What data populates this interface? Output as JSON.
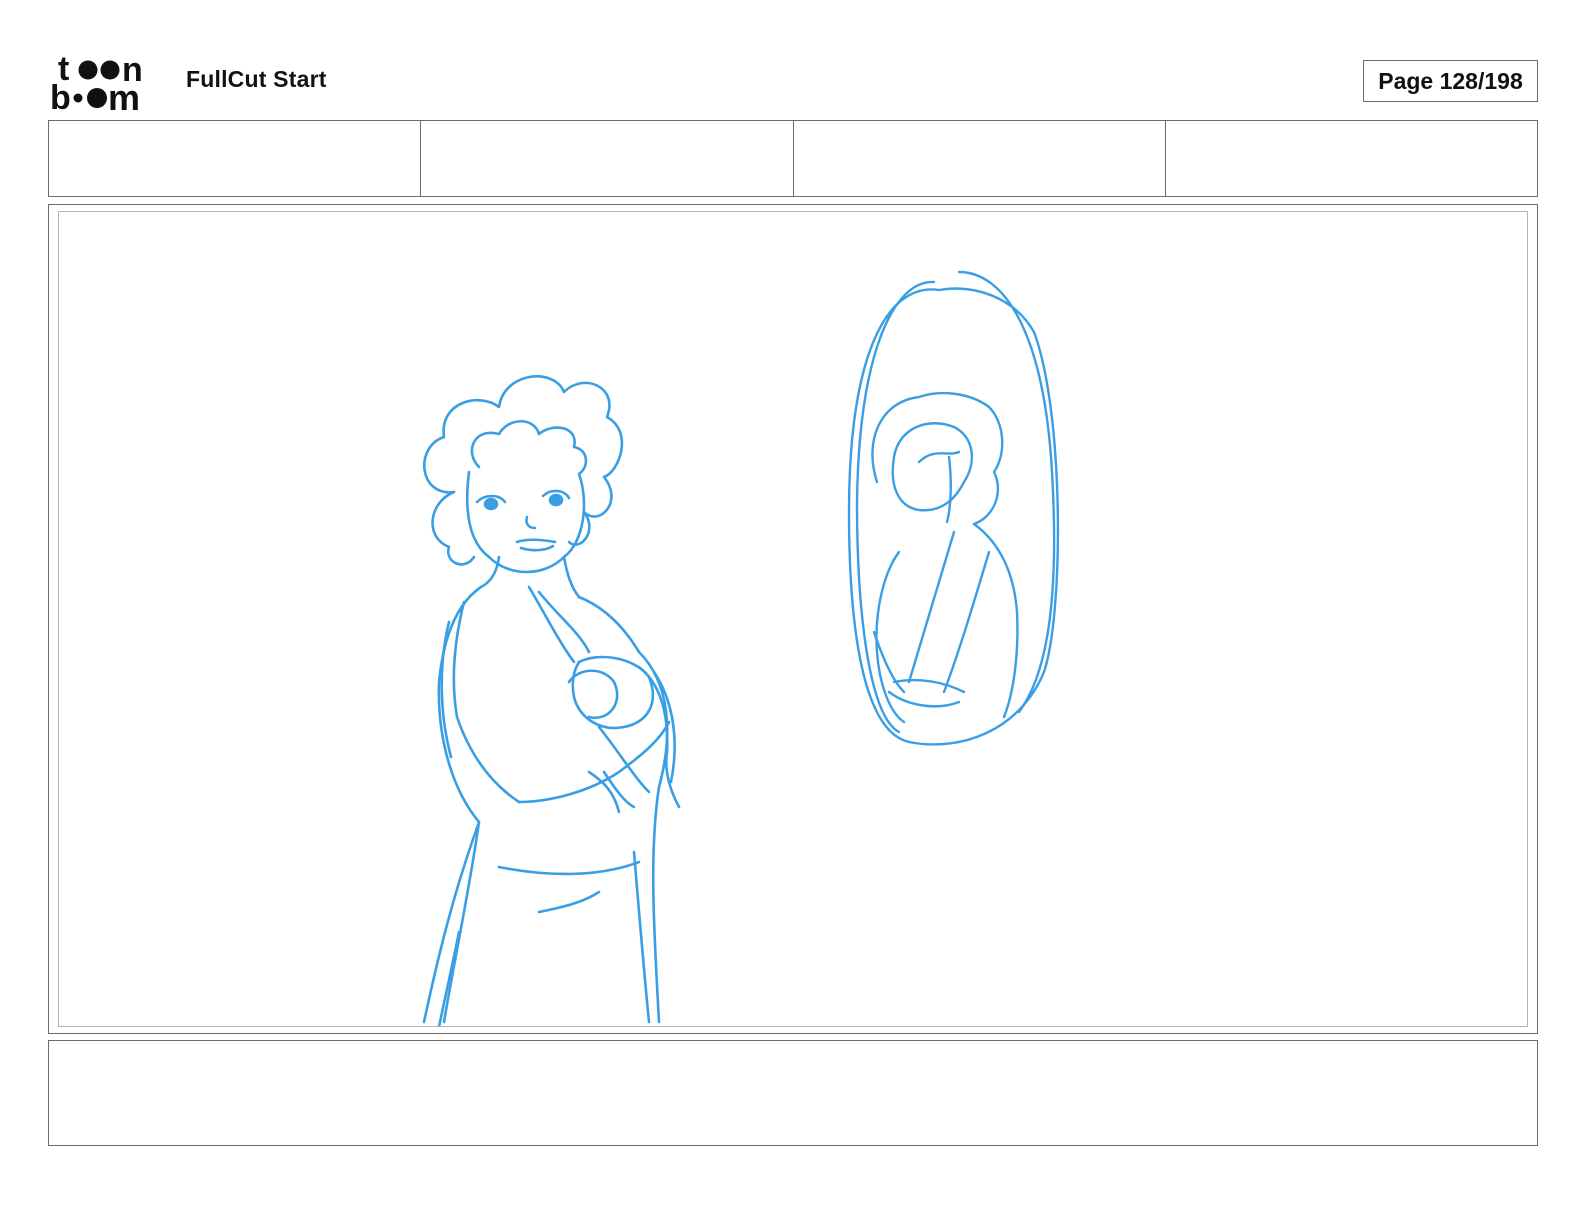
{
  "header": {
    "logo_top": "t••n",
    "logo_bottom": "b••m",
    "title": "FullCut Start",
    "page_indicator": "Page 128/198"
  },
  "info_fields": [
    "",
    "",
    "",
    ""
  ],
  "panel": {
    "sketch_color": "#3a9ee4",
    "subjects": [
      "curly-haired girl with crossed arms",
      "oval mirror with reflection"
    ]
  },
  "caption": {
    "text": ""
  }
}
